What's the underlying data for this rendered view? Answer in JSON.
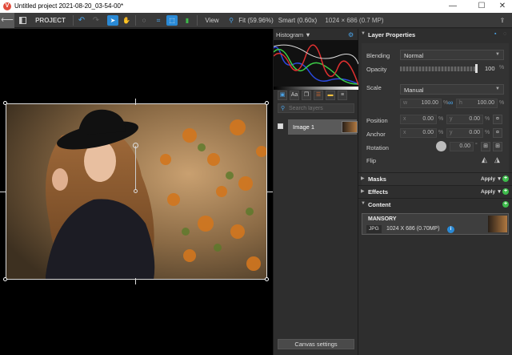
{
  "window": {
    "title": "Untitled project 2021-08-20_03-54-00*",
    "logo": "V",
    "minimize": "—",
    "maximize": "☐",
    "close": "✕"
  },
  "toolbar": {
    "project_label": "PROJECT ▼",
    "view_label": "View ▼",
    "fit_label": "Fit (59.96%) ▼",
    "smart_label": "Smart (0.60x) ▼",
    "dimensions": "1024 × 686 (0.7 MP)"
  },
  "histogram": {
    "title": "Histogram ▼"
  },
  "layers": {
    "search_placeholder": "Search layers",
    "items": [
      {
        "name": "Image 1"
      }
    ],
    "canvas_settings": "Canvas settings",
    "tool_aa": "Aa"
  },
  "props": {
    "title": "Layer Properties",
    "blending_label": "Blending",
    "blending_value": "Normal",
    "opacity_label": "Opacity",
    "opacity_value": "100",
    "opacity_unit": "%",
    "scale_label": "Scale",
    "scale_value": "Manual",
    "w_prefix": "w",
    "w_value": "100.00",
    "w_unit": "%",
    "h_prefix": "h",
    "h_value": "100.00",
    "h_unit": "%",
    "position_label": "Position",
    "pos_x_prefix": "x",
    "pos_x": "0.00",
    "pos_x_unit": "%",
    "pos_y_prefix": "y",
    "pos_y": "0.00",
    "pos_y_unit": "%",
    "anchor_label": "Anchor",
    "anc_x_prefix": "x",
    "anc_x": "0.00",
    "anc_x_unit": "%",
    "anc_y_prefix": "y",
    "anc_y": "0.00",
    "anc_y_unit": "%",
    "rotation_label": "Rotation",
    "rotation_value": "0.00",
    "rotation_unit": "°",
    "flip_label": "Flip"
  },
  "sections": {
    "masks": "Masks",
    "effects": "Effects",
    "content": "Content",
    "apply": "Apply ▼"
  },
  "content": {
    "name": "MANSORY",
    "format": "JPG",
    "info": "1024 X 686 (0.70MP)"
  }
}
